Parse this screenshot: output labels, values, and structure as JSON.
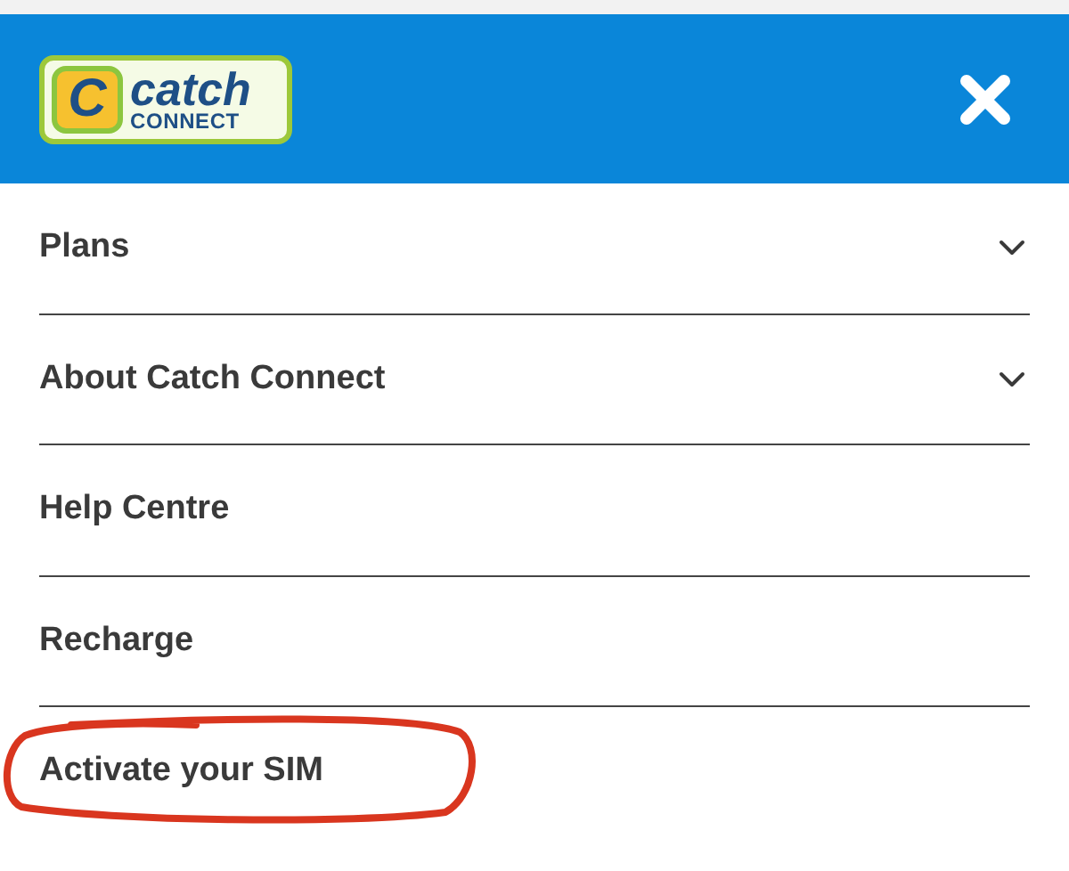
{
  "header": {
    "logo": {
      "mark": "C",
      "name": "catch",
      "sub": "CONNECT"
    }
  },
  "menu": [
    {
      "label": "Plans",
      "kind": "expandable",
      "expanded": false
    },
    {
      "label": "About Catch Connect",
      "kind": "expandable",
      "expanded": false
    },
    {
      "label": "Help Centre",
      "kind": "link"
    },
    {
      "label": "Recharge",
      "kind": "link"
    },
    {
      "label": "Activate your SIM",
      "kind": "link",
      "highlighted": true
    }
  ]
}
